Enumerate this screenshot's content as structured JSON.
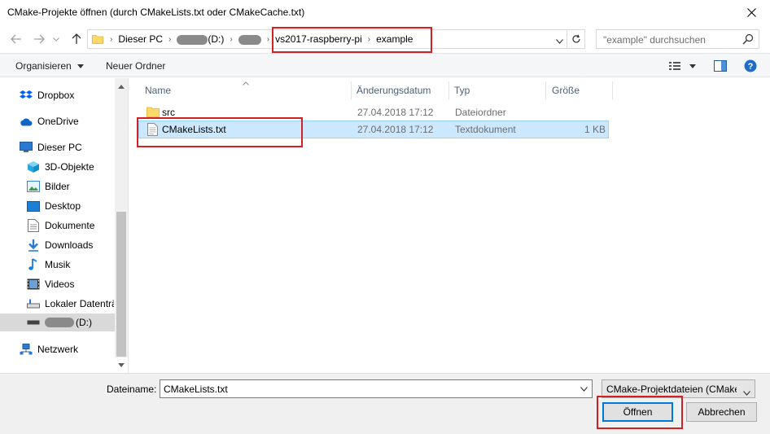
{
  "window": {
    "title": "CMake-Projekte öffnen (durch CMakeLists.txt oder CMakeCache.txt)"
  },
  "address": {
    "crumbs": [
      "Dieser PC",
      "(D:)",
      "vs2017-raspberry-pi",
      "example"
    ],
    "search_placeholder": "\"example\" durchsuchen"
  },
  "toolbar": {
    "organize": "Organisieren",
    "new_folder": "Neuer Ordner"
  },
  "sidebar": {
    "items": [
      {
        "label": "Dropbox",
        "icon": "dropbox-icon"
      },
      {
        "label": "OneDrive",
        "icon": "onedrive-icon"
      },
      {
        "label": "Dieser PC",
        "icon": "computer-icon"
      },
      {
        "label": "3D-Objekte",
        "icon": "cube-icon"
      },
      {
        "label": "Bilder",
        "icon": "pictures-icon"
      },
      {
        "label": "Desktop",
        "icon": "desktop-icon"
      },
      {
        "label": "Dokumente",
        "icon": "documents-icon"
      },
      {
        "label": "Downloads",
        "icon": "download-icon"
      },
      {
        "label": "Musik",
        "icon": "music-icon"
      },
      {
        "label": "Videos",
        "icon": "video-icon"
      },
      {
        "label": "Lokaler Datenträ",
        "icon": "drive-icon"
      },
      {
        "label": "(D:)",
        "icon": "drive-icon"
      },
      {
        "label": "Netzwerk",
        "icon": "network-icon"
      }
    ]
  },
  "columns": {
    "name": "Name",
    "date": "Änderungsdatum",
    "type": "Typ",
    "size": "Größe"
  },
  "files": [
    {
      "name": "src",
      "date": "27.04.2018 17:12",
      "type": "Dateiordner",
      "size": "",
      "icon": "folder-icon"
    },
    {
      "name": "CMakeLists.txt",
      "date": "27.04.2018 17:12",
      "type": "Textdokument",
      "size": "1 KB",
      "icon": "text-file-icon"
    }
  ],
  "bottom": {
    "filename_label": "Dateiname:",
    "filename_value": "CMakeLists.txt",
    "filter": "CMake-Projektdateien (CMake",
    "open": "Öffnen",
    "cancel": "Abbrechen"
  },
  "colors": {
    "highlight": "#d32020",
    "selection": "#cce8ff",
    "accent": "#0078d7"
  }
}
